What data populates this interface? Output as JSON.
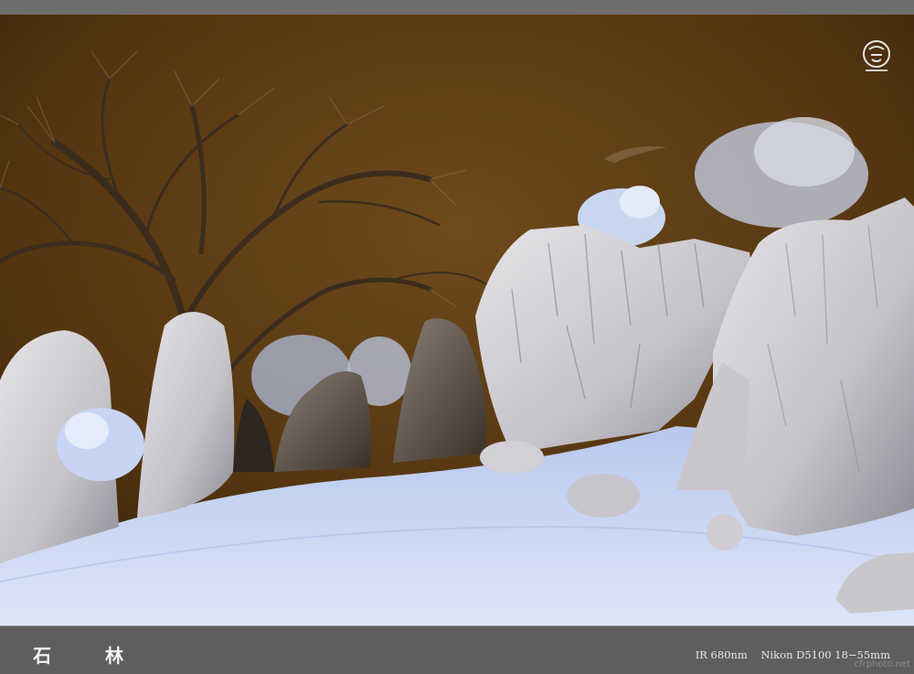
{
  "photo": {
    "caption_title": "石 林",
    "camera_info": "IR 680nm    Nikon D5100 18−55mm",
    "watermark_site": "cfrphoto.net",
    "logo_icon": "photographer-seal-icon",
    "colors": {
      "sky": "#5a3a12",
      "ground": "#c8d6f2",
      "rock": "#d6d6da",
      "frame": "#5f5f5f"
    }
  }
}
